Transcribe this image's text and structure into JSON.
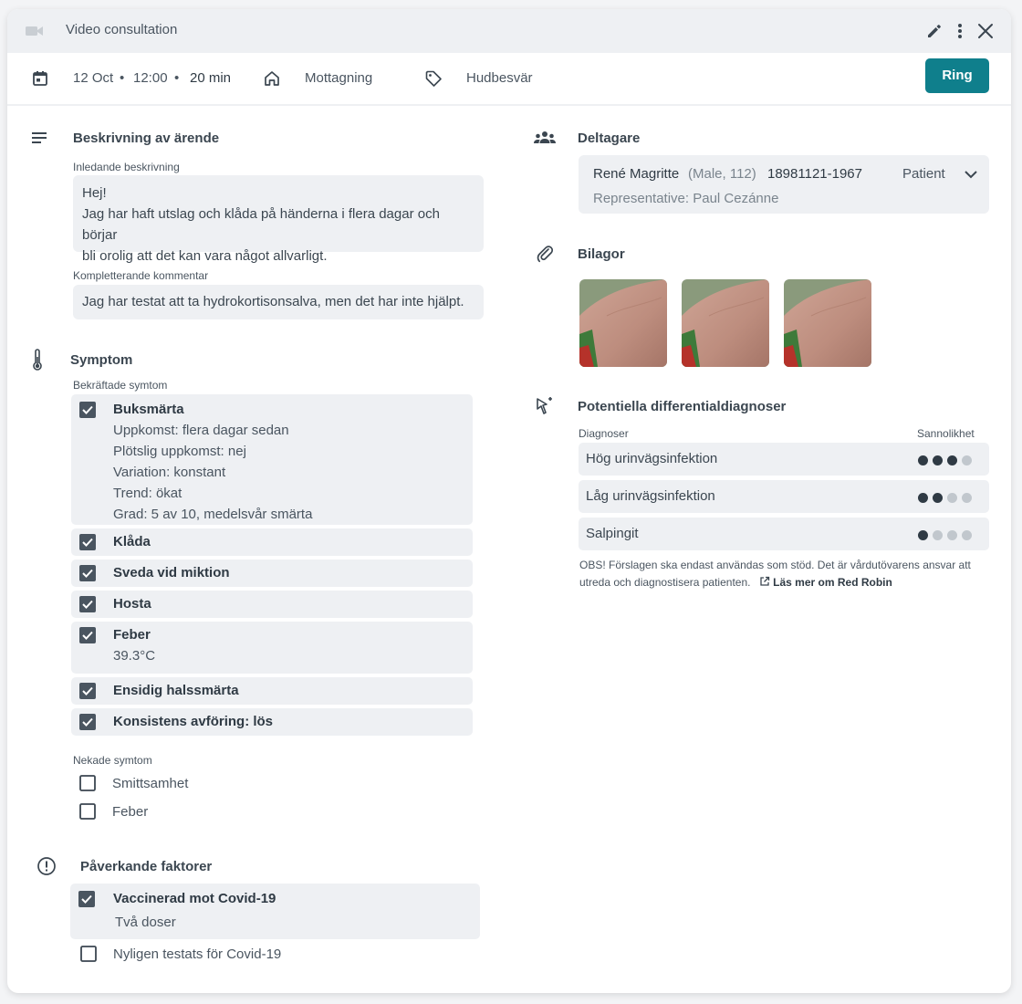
{
  "window": {
    "title": "Video consultation"
  },
  "info": {
    "date": "12 Oct",
    "time": "12:00",
    "duration": "20 min",
    "location": "Mottagning",
    "tag": "Hudbesvär",
    "call_label": "Ring"
  },
  "description": {
    "title": "Beskrivning av ärende",
    "initial_label": "Inledande beskrivning",
    "initial_lines": [
      "Hej!",
      "Jag har haft utslag och klåda på händerna i flera dagar och börjar",
      "bli orolig att det kan vara något allvarligt."
    ],
    "comment_label": "Kompletterande kommentar",
    "comment": "Jag har testat att ta hydrokortisonsalva, men det har inte hjälpt."
  },
  "symptoms": {
    "title": "Symptom",
    "confirmed_label": "Bekräftade symtom",
    "confirmed": [
      {
        "name": "Buksmärta",
        "details": [
          "Uppkomst: flera dagar sedan",
          "Plötslig uppkomst: nej",
          "Variation: konstant",
          "Trend: ökat",
          "Grad: 5 av 10, medelsvår smärta"
        ]
      },
      {
        "name": "Klåda",
        "details": []
      },
      {
        "name": "Sveda vid miktion",
        "details": []
      },
      {
        "name": "Hosta",
        "details": []
      },
      {
        "name": "Feber",
        "details": [
          "39.3°C"
        ]
      },
      {
        "name": "Ensidig halssmärta",
        "details": []
      },
      {
        "name": "Konsistens avföring: lös",
        "details": []
      }
    ],
    "denied_label": "Nekade symtom",
    "denied": [
      "Smittsamhet",
      "Feber"
    ]
  },
  "factors": {
    "title": "Påverkande faktorer",
    "items": [
      {
        "name": "Vaccinerad mot Covid-19",
        "checked": true,
        "detail": "Två doser"
      },
      {
        "name": "Nyligen testats för Covid-19",
        "checked": false,
        "detail": ""
      }
    ]
  },
  "participants": {
    "title": "Deltagare",
    "name": "René Magritte",
    "meta": "(Male, 112)",
    "id": "18981121-1967",
    "role": "Patient",
    "representative": "Representative: Paul Cezánne"
  },
  "attachments": {
    "title": "Bilagor",
    "count": 3
  },
  "diagnoses": {
    "title": "Potentiella differentialdiagnoser",
    "col_diag": "Diagnoser",
    "col_prob": "Sannolikhet",
    "items": [
      {
        "name": "Hög urinvägsinfektion",
        "level": 3
      },
      {
        "name": "Låg urinvägsinfektion",
        "level": 2
      },
      {
        "name": "Salpingit",
        "level": 1
      }
    ],
    "disclaimer_line1": "OBS! Förslagen ska endast användas som stöd. Det är vårdutövarens ansvar att",
    "disclaimer_line2": "utreda och diagnostisera patienten.",
    "link": "Läs mer om Red Robin"
  },
  "colors": {
    "accent": "#0f7f8c",
    "panel": "#eef0f3",
    "text": "#3b4650"
  }
}
